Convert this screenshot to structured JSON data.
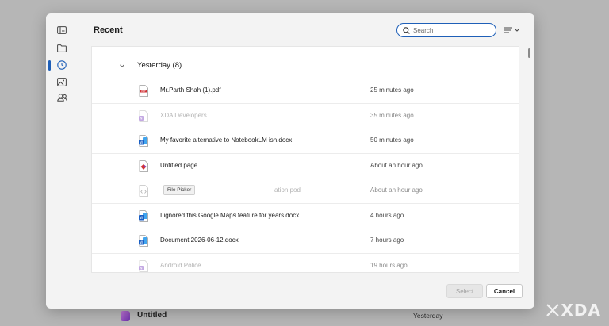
{
  "background": {
    "item_title": "Untitled",
    "item_date": "Yesterday",
    "watermark_text": "XDA"
  },
  "dialog": {
    "title": "Recent",
    "search": {
      "placeholder": "Search",
      "value": ""
    },
    "nav": [
      "home-icon",
      "folder-icon",
      "clock-icon",
      "image-icon",
      "people-icon"
    ],
    "group": {
      "label": "Yesterday (8)"
    },
    "files": [
      {
        "name": "Mr.Parth Shah (1).pdf",
        "time": "25 minutes ago",
        "type": "pdf",
        "dim": false
      },
      {
        "name": "XDA Developers",
        "time": "35 minutes ago",
        "type": "onenote",
        "dim": true
      },
      {
        "name": "My favorite alternative to NotebookLM isn.docx",
        "time": "50 minutes ago",
        "type": "word",
        "dim": false
      },
      {
        "name": "Untitled.page",
        "time": "About an hour ago",
        "type": "loop",
        "dim": false
      },
      {
        "name": "File Picker",
        "time": "About an hour ago",
        "type": "code",
        "dim": true,
        "tooltip_covered_name": "ation.pod"
      },
      {
        "name": "I ignored this Google Maps feature for years.docx",
        "time": "4 hours ago",
        "type": "word",
        "dim": false
      },
      {
        "name": "Document 2026-06-12.docx",
        "time": "7 hours ago",
        "type": "word",
        "dim": false
      },
      {
        "name": "Android Police",
        "time": "19 hours ago",
        "type": "onenote",
        "dim": true
      }
    ],
    "tooltip": "File Picker",
    "buttons": {
      "select": "Select",
      "cancel": "Cancel"
    }
  },
  "colors": {
    "accent": "#1e5fb8",
    "word": "#1a5fc4",
    "onenote": "#7b3fbf",
    "pdf": "#d13438"
  }
}
